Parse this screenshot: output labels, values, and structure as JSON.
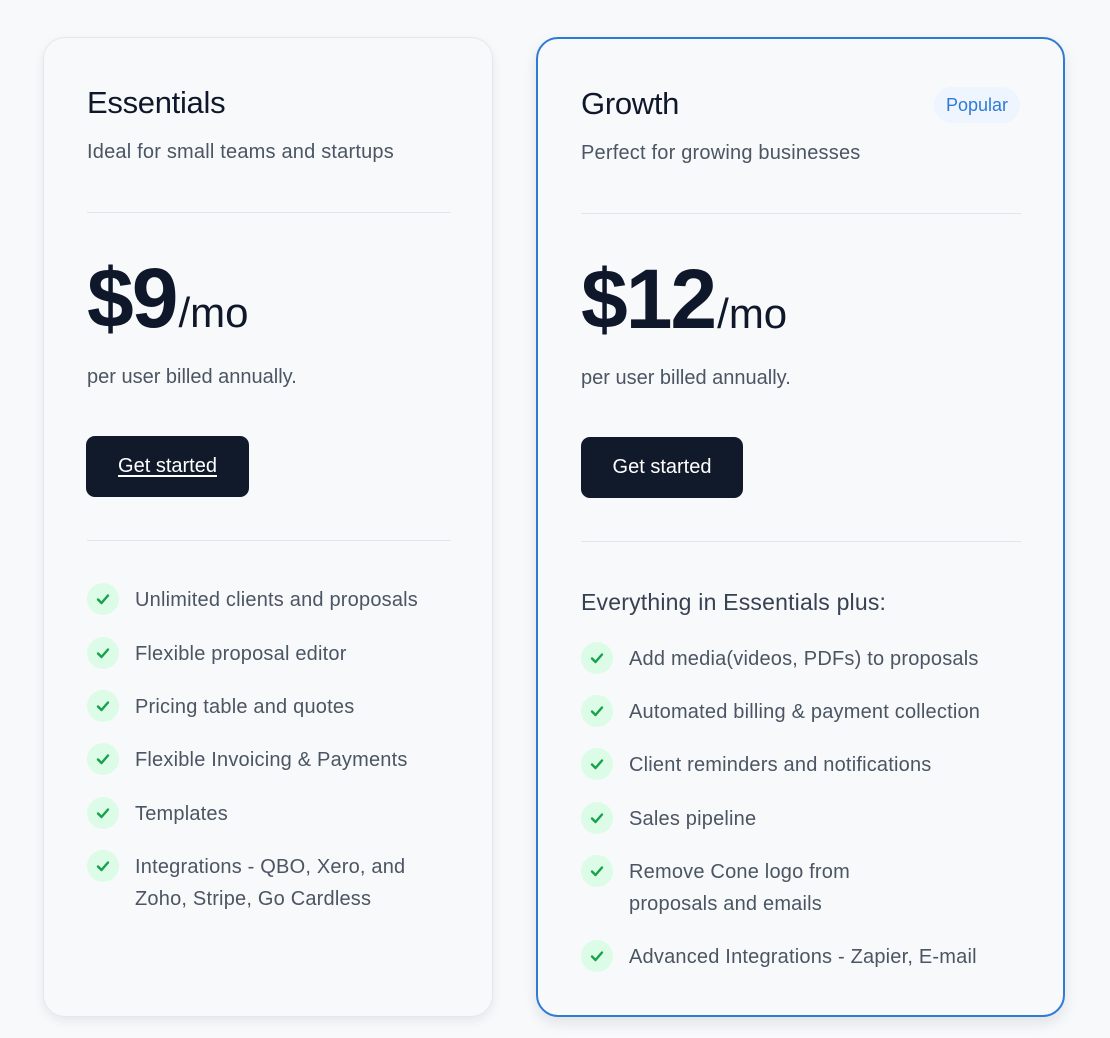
{
  "plans": [
    {
      "name": "Essentials",
      "description": "Ideal for small teams and startups",
      "price": "$9",
      "period": "/mo",
      "price_note": "per user billed annually.",
      "cta_label": "Get started",
      "features": [
        "Unlimited clients and proposals",
        "Flexible proposal editor",
        "Pricing table and quotes",
        "Flexible Invoicing & Payments",
        "Templates",
        "Integrations - QBO, Xero, and",
        "Zoho, Stripe, Go Cardless"
      ]
    },
    {
      "name": "Growth",
      "badge": "Popular",
      "description": "Perfect for growing businesses",
      "price": "$12",
      "period": "/mo",
      "price_note": "per user billed annually.",
      "cta_label": "Get started",
      "features_intro": "Everything in Essentials plus:",
      "features": [
        "Add media(videos, PDFs) to proposals",
        "Automated billing & payment collection",
        "Client reminders and notifications",
        "Sales pipeline",
        "Remove Cone logo from",
        "proposals and emails",
        "Advanced Integrations - Zapier, E-mail"
      ]
    }
  ],
  "colors": {
    "accent_border": "#2e7bd6",
    "badge_bg": "#eef5fe",
    "check_bg": "#dcfce7",
    "check_mark": "#16a34a",
    "button_bg": "#111a2b"
  },
  "icons": {
    "feature_check": "check-icon"
  }
}
